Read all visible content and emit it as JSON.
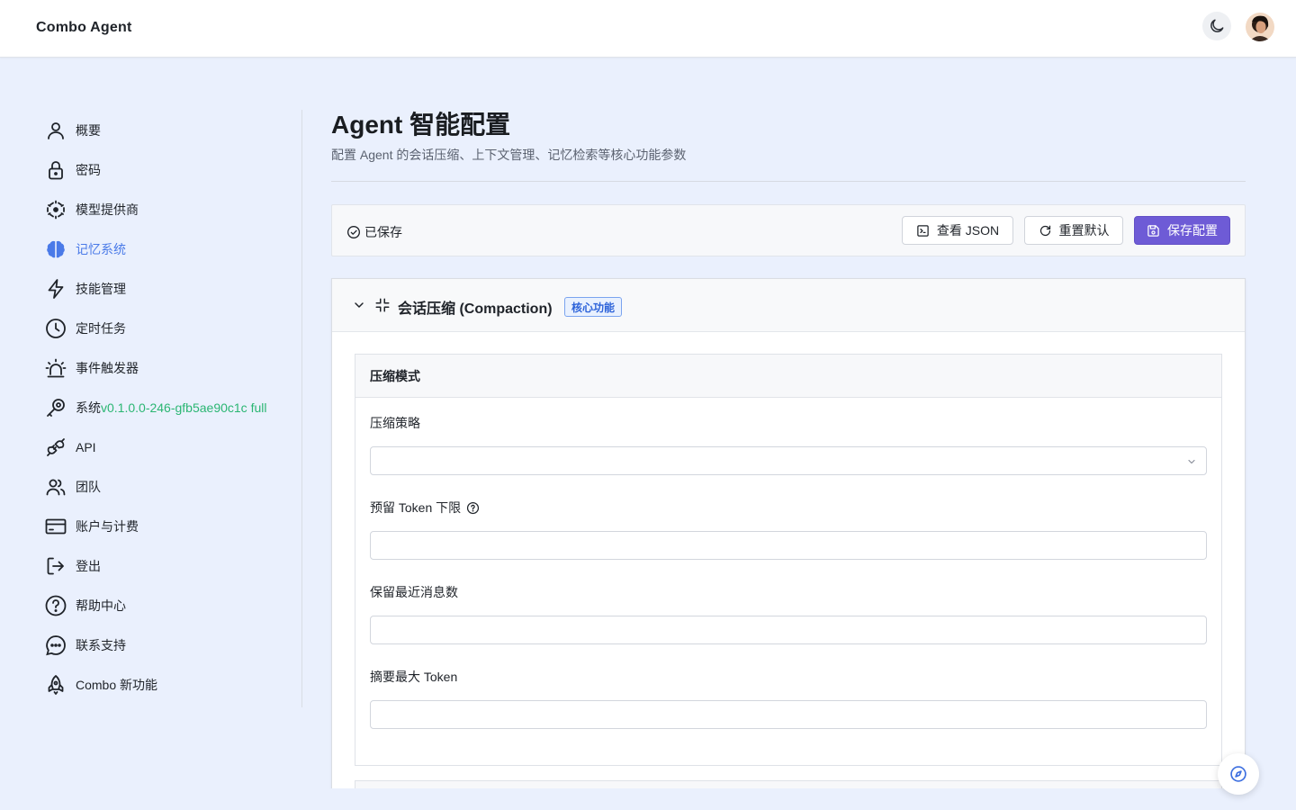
{
  "app": {
    "brand": "Combo Agent"
  },
  "sidebar": {
    "items": [
      {
        "label": "概要",
        "icon": "user-icon"
      },
      {
        "label": "密码",
        "icon": "lock-icon"
      },
      {
        "label": "模型提供商",
        "icon": "model-provider-icon"
      },
      {
        "label": "记忆系统",
        "icon": "brain-icon",
        "active": true
      },
      {
        "label": "技能管理",
        "icon": "lightning-icon"
      },
      {
        "label": "定时任务",
        "icon": "clock-icon"
      },
      {
        "label": "事件触发器",
        "icon": "alarm-icon"
      },
      {
        "label": "系统",
        "version": "v0.1.0.0-246-gfb5ae90c1c full",
        "icon": "wrench-icon"
      },
      {
        "label": "API",
        "icon": "plug-icon"
      },
      {
        "label": "团队",
        "icon": "team-icon"
      },
      {
        "label": "账户与计费",
        "icon": "credit-card-icon"
      },
      {
        "label": "登出",
        "icon": "logout-icon"
      },
      {
        "label": "帮助中心",
        "icon": "help-icon"
      },
      {
        "label": "联系支持",
        "icon": "chat-icon"
      },
      {
        "label": "Combo 新功能",
        "icon": "rocket-icon"
      }
    ]
  },
  "main": {
    "title": "Agent 智能配置",
    "subtitle": "配置 Agent 的会话压缩、上下文管理、记忆检索等核心功能参数"
  },
  "toolbar": {
    "status": "已保存",
    "view_json": "查看 JSON",
    "reset": "重置默认",
    "save": "保存配置"
  },
  "compaction": {
    "title": "会话压缩 (Compaction)",
    "badge": "核心功能",
    "section_title": "压缩模式",
    "fields": {
      "strategy": {
        "label": "压缩策略",
        "value": ""
      },
      "reserve_tokens": {
        "label": "预留 Token 下限",
        "value": ""
      },
      "keep_recent": {
        "label": "保留最近消息数",
        "value": ""
      },
      "summary_max": {
        "label": "摘要最大 Token",
        "value": ""
      }
    }
  },
  "colors": {
    "accent": "#4a7ae8",
    "primary_button": "#6e5bd6",
    "version_text": "#2bb673",
    "page_bg": "#eaf0fd"
  }
}
